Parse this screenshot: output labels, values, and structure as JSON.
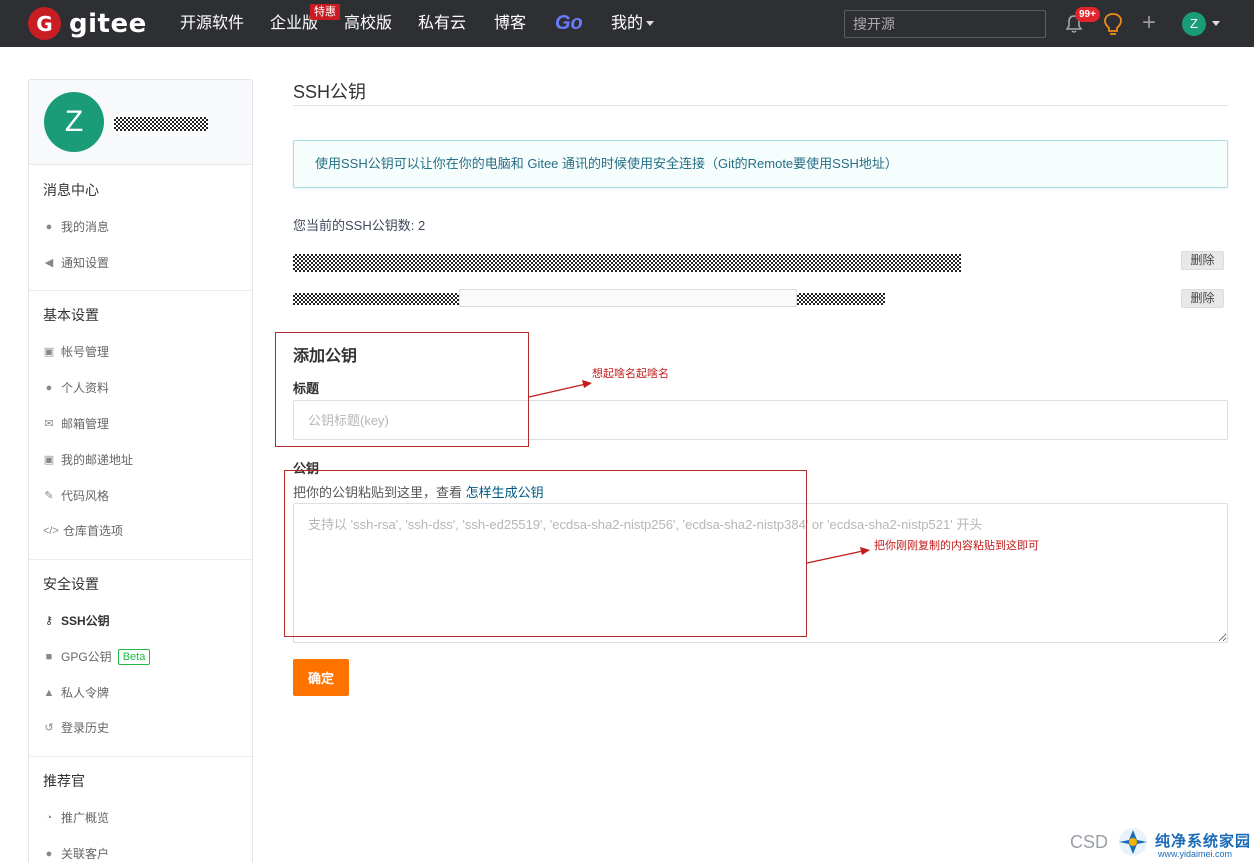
{
  "nav": {
    "logo_mark": "G",
    "logo_text": "gitee",
    "items": [
      "开源软件",
      "企业版",
      "高校版",
      "私有云",
      "博客",
      "Go",
      "我的"
    ],
    "promo_badge": "特惠",
    "search_placeholder": "搜开源",
    "notif_badge": "99+",
    "plus": "+",
    "user_initial": "Z",
    "accent_color": "#c71d23"
  },
  "sidebar": {
    "avatar_initial": "Z",
    "sections": [
      {
        "title": "消息中心",
        "items": [
          {
            "label": "我的消息",
            "icon": "bell-icon"
          },
          {
            "label": "通知设置",
            "icon": "speaker-icon"
          }
        ]
      },
      {
        "title": "基本设置",
        "items": [
          {
            "label": "帐号管理",
            "icon": "id-card-icon"
          },
          {
            "label": "个人资料",
            "icon": "user-icon"
          },
          {
            "label": "邮箱管理",
            "icon": "mail-icon"
          },
          {
            "label": "我的邮递地址",
            "icon": "address-card-icon"
          },
          {
            "label": "代码风格",
            "icon": "paintbrush-icon"
          },
          {
            "label": "仓库首选项",
            "icon": "code-icon"
          }
        ]
      },
      {
        "title": "安全设置",
        "items": [
          {
            "label": "SSH公钥",
            "icon": "key-icon",
            "active": true
          },
          {
            "label": "GPG公钥",
            "icon": "lock-icon",
            "badge": "Beta"
          },
          {
            "label": "私人令牌",
            "icon": "token-icon"
          },
          {
            "label": "登录历史",
            "icon": "history-icon"
          }
        ]
      },
      {
        "title": "推荐官",
        "items": [
          {
            "label": "推广概览",
            "icon": "chart-pie-icon"
          },
          {
            "label": "关联客户",
            "icon": "users-icon"
          }
        ]
      }
    ]
  },
  "main": {
    "title": "SSH公钥",
    "info": "使用SSH公钥可以让你在你的电脑和 Gitee 通讯的时候使用安全连接（Git的Remote要使用SSH地址）",
    "key_count": "您当前的SSH公钥数: 2",
    "delete_label": "删除",
    "add_title": "添加公钥",
    "title_label": "标题",
    "title_placeholder": "公钥标题(key)",
    "key_label": "公钥",
    "key_hint_prefix": "把你的公钥粘贴到这里，查看 ",
    "key_hint_link": "怎样生成公钥",
    "key_placeholder": "支持以 'ssh-rsa', 'ssh-dss', 'ssh-ed25519', 'ecdsa-sha2-nistp256', 'ecdsa-sha2-nistp384' or 'ecdsa-sha2-nistp521' 开头",
    "submit_label": "确定"
  },
  "annotations": {
    "title_note": "想起啥名起啥名",
    "key_note": "把你刚刚复制的内容粘贴到这即可"
  },
  "watermark": {
    "csd": "CSD",
    "site_name": "纯净系统家园",
    "site_url": "www.yidaimei.com"
  }
}
